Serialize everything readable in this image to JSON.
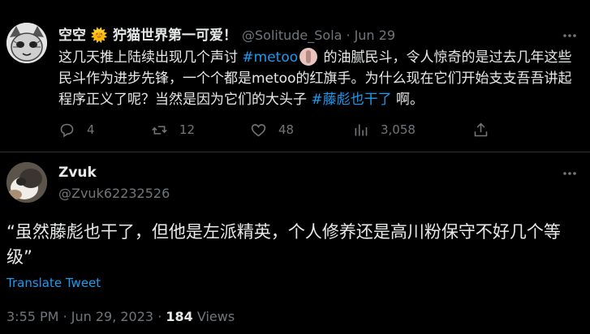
{
  "tweet1": {
    "display_name": "空空 🌞 狞猫世界第一可爱！",
    "handle": "@Solitude_Sola",
    "separator": "·",
    "date": "Jun 29",
    "body_part1": "这几天推上陆续出现几个声讨 ",
    "hashtag_metoo": "#metoo",
    "body_part2": " 的油腻民斗，令人惊奇的是过去几年这些民斗作为进步先锋，一个个都是metoo的红旗手。为什么现在它们开始支支吾吾讲起程序正义了呢？当然是因为它们的大头子 ",
    "hashtag_name": "#藤彪也干了",
    "body_part3": " 啊。",
    "actions": {
      "replies": "4",
      "retweets": "12",
      "likes": "48",
      "views": "3,058"
    },
    "icons": [
      "reply-icon",
      "retweet-icon",
      "like-icon",
      "views-icon",
      "share-icon"
    ]
  },
  "tweet2": {
    "display_name": "Zvuk",
    "handle": "@Zvuk62232526",
    "text": "“虽然藤彪也干了，但他是左派精英，个人修养还是高川粉保守不好几个等级”",
    "translate_label": "Translate Tweet",
    "time": "3:55 PM",
    "separator": "·",
    "date": "Jun 29, 2023",
    "views_count": "184",
    "views_label": "Views"
  },
  "colors": {
    "background": "#000000",
    "text_primary": "#e7e9ea",
    "text_secondary": "#71767b",
    "link": "#1d9bf0",
    "divider": "#2f3336"
  }
}
